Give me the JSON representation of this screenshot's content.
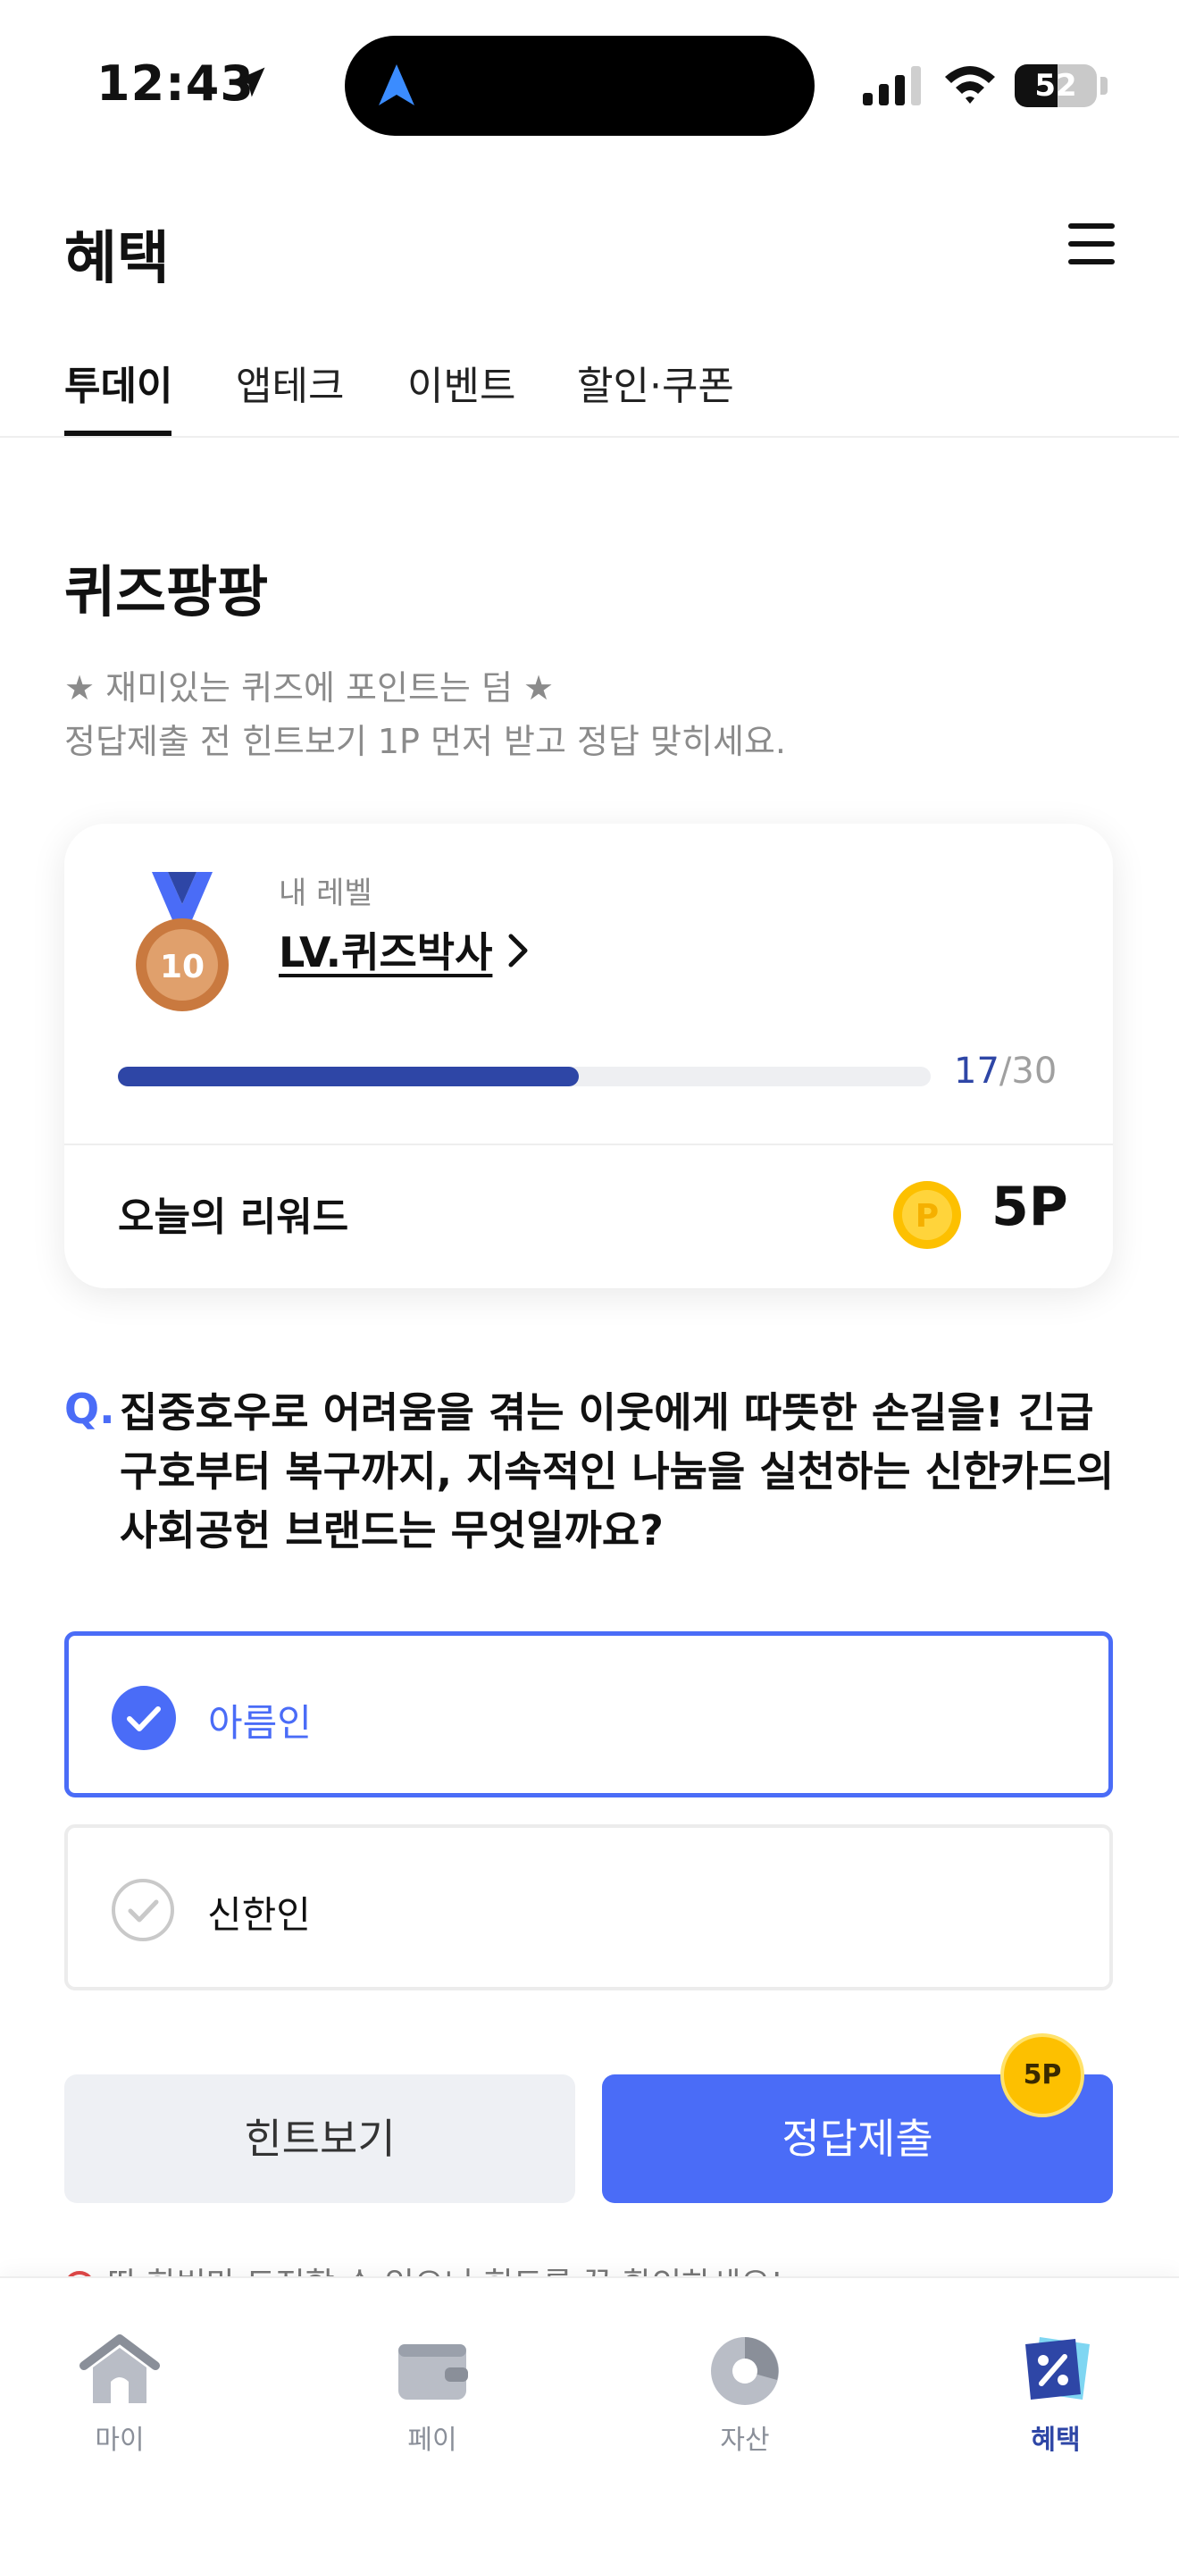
{
  "status_bar": {
    "time": "12:43",
    "battery": "52",
    "battery_level": 0.52
  },
  "header": {
    "title": "혜택"
  },
  "tabs": [
    {
      "label": "투데이",
      "active": true
    },
    {
      "label": "앱테크",
      "active": false
    },
    {
      "label": "이벤트",
      "active": false
    },
    {
      "label": "할인·쿠폰",
      "active": false
    }
  ],
  "quiz": {
    "title": "퀴즈팡팡",
    "description_line1": "★ 재미있는 퀴즈에 포인트는 덤 ★",
    "description_line2": "정답제출 전 힌트보기 1P 먼저 받고 정답 맞히세요.",
    "level_card": {
      "caption": "내 레벨",
      "level_name": "LV.퀴즈박사",
      "medal_number": "10",
      "progress_current": "17",
      "progress_total": "/30",
      "progress_fraction": 0.567,
      "reward_label": "오늘의 리워드",
      "reward_value": "5P",
      "coin_letter": "P"
    },
    "question": {
      "marker": "Q.",
      "text": "집중호우로 어려움을 겪는 이웃에게 따뜻한 손길을! 긴급 구호부터 복구까지, 지속적인 나눔을 실천하는 신한카드의 사회공헌 브랜드는 무엇일까요?"
    },
    "options": [
      {
        "label": "아름인",
        "selected": true
      },
      {
        "label": "신한인",
        "selected": false
      }
    ],
    "hint_button": "힌트보기",
    "submit_button": "정답제출",
    "submit_badge": "5P",
    "warning": "딱 한번만 도전할 수 있으니 힌트를 꼭 확인하세요!"
  },
  "bottom_nav": [
    {
      "label": "마이",
      "icon": "home-icon",
      "active": false
    },
    {
      "label": "페이",
      "icon": "wallet-icon",
      "active": false
    },
    {
      "label": "자산",
      "icon": "pie-chart-icon",
      "active": false
    },
    {
      "label": "혜택",
      "icon": "benefit-coupon-icon",
      "active": true
    }
  ],
  "colors": {
    "accent": "#4a6cf7",
    "navy": "#2e46a6",
    "coin": "#fdc000"
  }
}
